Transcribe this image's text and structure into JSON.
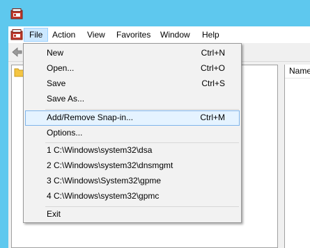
{
  "menubar": {
    "items": [
      {
        "label": "File"
      },
      {
        "label": "Action"
      },
      {
        "label": "View"
      },
      {
        "label": "Favorites"
      },
      {
        "label": "Window"
      },
      {
        "label": "Help"
      }
    ]
  },
  "list_pane": {
    "column_header": "Name"
  },
  "file_menu": {
    "items": [
      {
        "label": "New",
        "shortcut": "Ctrl+N"
      },
      {
        "label": "Open...",
        "shortcut": "Ctrl+O"
      },
      {
        "label": "Save",
        "shortcut": "Ctrl+S"
      },
      {
        "label": "Save As...",
        "shortcut": ""
      },
      {
        "label": "Add/Remove Snap-in...",
        "shortcut": "Ctrl+M"
      },
      {
        "label": "Options...",
        "shortcut": ""
      },
      {
        "label": "1 C:\\Windows\\system32\\dsa",
        "shortcut": ""
      },
      {
        "label": "2 C:\\Windows\\system32\\dnsmgmt",
        "shortcut": ""
      },
      {
        "label": "3 C:\\Windows\\System32\\gpme",
        "shortcut": ""
      },
      {
        "label": "4 C:\\Windows\\system32\\gpmc",
        "shortcut": ""
      },
      {
        "label": "Exit",
        "shortcut": ""
      }
    ]
  },
  "colors": {
    "titlebar": "#5ec8ee",
    "menu_active_bg": "#cce8ff",
    "menu_hover_bg": "#e5f3ff"
  }
}
